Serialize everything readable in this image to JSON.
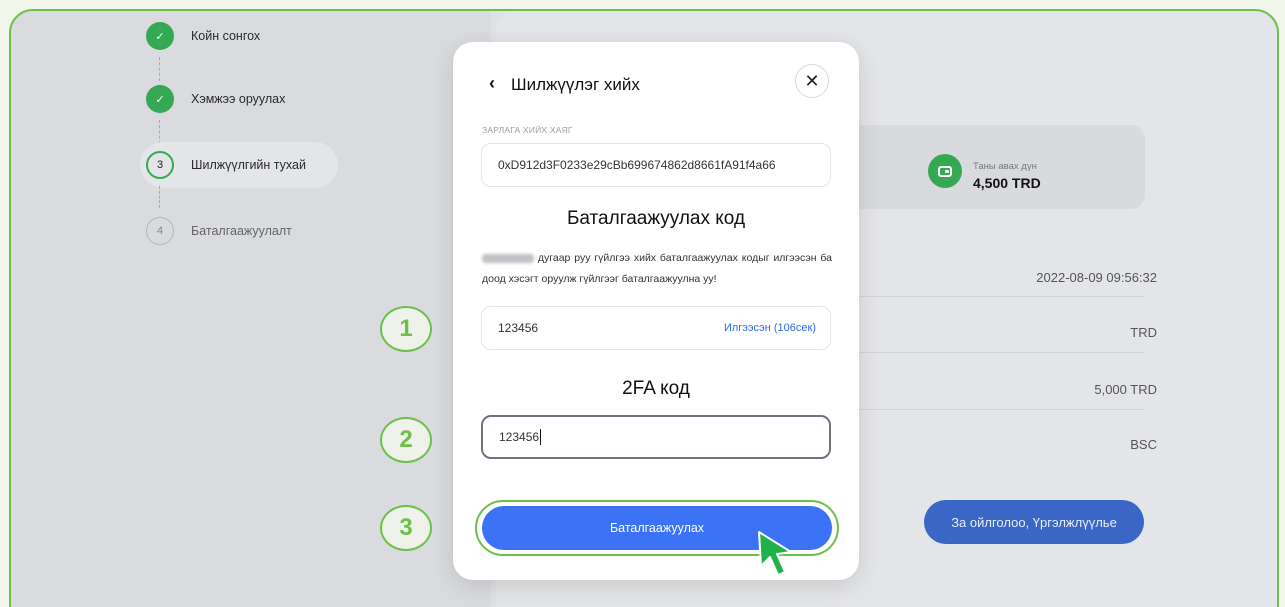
{
  "steps": [
    {
      "num": "",
      "label": "Койн сонгох",
      "state": "done"
    },
    {
      "num": "",
      "label": "Хэмжээ оруулах",
      "state": "done"
    },
    {
      "num": "3",
      "label": "Шилжүүлгийн тухай",
      "state": "current"
    },
    {
      "num": "4",
      "label": "Баталгаажуулалт",
      "state": "todo"
    }
  ],
  "summary": {
    "receive_label": "Таны авах дүн",
    "receive_value": "4,500 TRD",
    "rows": [
      "2022-08-09 09:56:32",
      "TRD",
      "5,000 TRD",
      "BSC"
    ],
    "primary_button": "За ойлголоо, Үргэлжлүүлье"
  },
  "modal": {
    "back_icon": "‹",
    "title": "Шилжүүлэг хийх",
    "close_icon": "✕",
    "address_label": "ЗАРЛАГА ХИЙХ ХАЯГ",
    "address_value": "0xD912d3F0233e29cBb699674862d8661fA91f4a66",
    "verify_heading": "Баталгаажуулах код",
    "verify_desc": "дугаар руу гүйлгээ хийх баталгаажуулах кодыг илгээсэн ба доод хэсэгт оруулж гүйлгээг баталгаажуулна уу!",
    "code_value": "123456",
    "resend_label": "Илгээсэн (106сек)",
    "twofa_heading": "2FA код",
    "twofa_value": "123456",
    "confirm_button": "Баталгаажуулах"
  },
  "badges": [
    "1",
    "2",
    "3"
  ],
  "colors": {
    "accent_green": "#6cc04a",
    "success_green": "#34a853",
    "primary_blue": "#3b72f6",
    "link_blue": "#2e6be6"
  }
}
